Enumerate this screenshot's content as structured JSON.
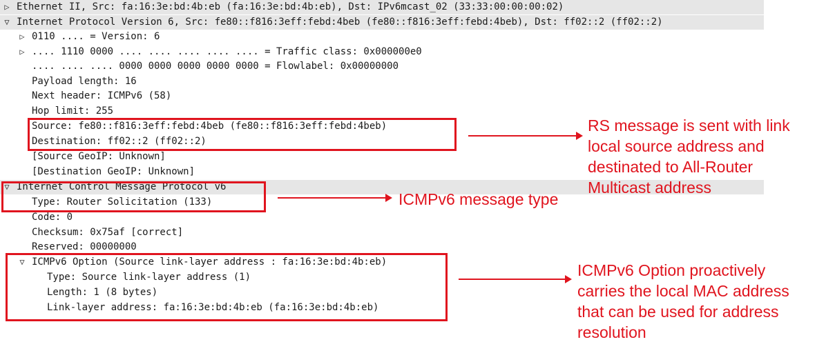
{
  "tree": {
    "rows": [
      {
        "text": "Ethernet II, Src: fa:16:3e:bd:4b:eb (fa:16:3e:bd:4b:eb), Dst: IPv6mcast_02 (33:33:00:00:00:02)",
        "toggle": "▷",
        "level": 0,
        "shaded": true
      },
      {
        "text": "Internet Protocol Version 6, Src: fe80::f816:3eff:febd:4beb (fe80::f816:3eff:febd:4beb), Dst: ff02::2 (ff02::2)",
        "toggle": "▽",
        "level": 0,
        "shaded": true
      },
      {
        "text": "0110 .... = Version: 6",
        "toggle": "▷",
        "level": 1,
        "shaded": false
      },
      {
        "text": ".... 1110 0000 .... .... .... .... .... = Traffic class: 0x000000e0",
        "toggle": "▷",
        "level": 1,
        "shaded": false
      },
      {
        "text": ".... .... .... 0000 0000 0000 0000 0000 = Flowlabel: 0x00000000",
        "toggle": "",
        "level": 1,
        "shaded": false
      },
      {
        "text": "Payload length: 16",
        "toggle": "",
        "level": 1,
        "shaded": false
      },
      {
        "text": "Next header: ICMPv6 (58)",
        "toggle": "",
        "level": 1,
        "shaded": false
      },
      {
        "text": "Hop limit: 255",
        "toggle": "",
        "level": 1,
        "shaded": false
      },
      {
        "text": "Source: fe80::f816:3eff:febd:4beb (fe80::f816:3eff:febd:4beb)",
        "toggle": "",
        "level": 1,
        "shaded": false
      },
      {
        "text": "Destination: ff02::2 (ff02::2)",
        "toggle": "",
        "level": 1,
        "shaded": false
      },
      {
        "text": "[Source GeoIP: Unknown]",
        "toggle": "",
        "level": 1,
        "shaded": false
      },
      {
        "text": "[Destination GeoIP: Unknown]",
        "toggle": "",
        "level": 1,
        "shaded": false
      },
      {
        "text": "Internet Control Message Protocol v6",
        "toggle": "▽",
        "level": 0,
        "shaded": true
      },
      {
        "text": "Type: Router Solicitation (133)",
        "toggle": "",
        "level": 1,
        "shaded": false
      },
      {
        "text": "Code: 0",
        "toggle": "",
        "level": 1,
        "shaded": false
      },
      {
        "text": "Checksum: 0x75af [correct]",
        "toggle": "",
        "level": 1,
        "shaded": false
      },
      {
        "text": "Reserved: 00000000",
        "toggle": "",
        "level": 1,
        "shaded": false
      },
      {
        "text": "ICMPv6 Option (Source link-layer address : fa:16:3e:bd:4b:eb)",
        "toggle": "▽",
        "level": 1,
        "shaded": false
      },
      {
        "text": "Type: Source link-layer address (1)",
        "toggle": "",
        "level": 2,
        "shaded": false
      },
      {
        "text": "Length: 1 (8 bytes)",
        "toggle": "",
        "level": 2,
        "shaded": false
      },
      {
        "text": "Link-layer address: fa:16:3e:bd:4b:eb (fa:16:3e:bd:4b:eb)",
        "toggle": "",
        "level": 2,
        "shaded": false
      }
    ]
  },
  "annotations": {
    "rs": [
      "RS message is sent with link",
      "local source address and",
      "destinated to All-Router",
      "Multicast address"
    ],
    "type": [
      "ICMPv6 message type"
    ],
    "option": [
      "ICMPv6 Option proactively",
      "carries the local MAC address",
      "that can be used for address",
      "resolution"
    ]
  },
  "colors": {
    "highlight": "#e0141e",
    "header_bg": "#e6e6e6"
  }
}
